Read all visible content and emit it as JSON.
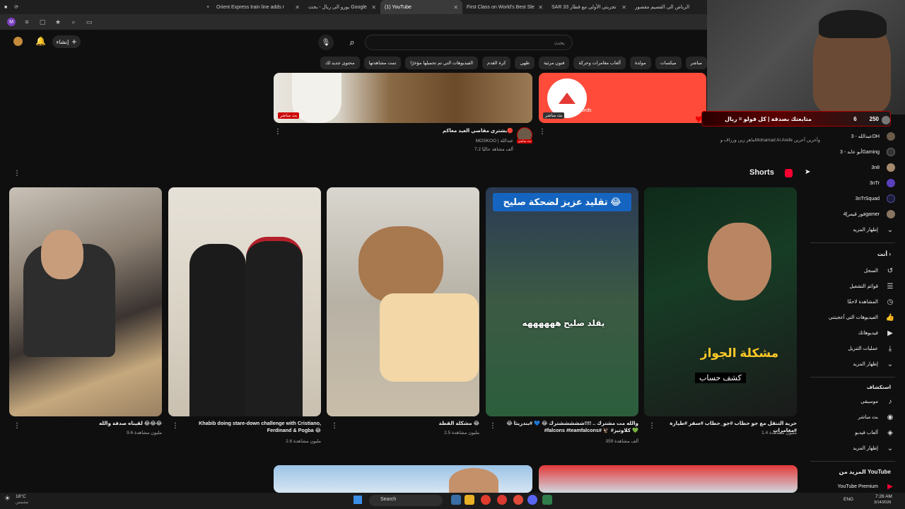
{
  "browser": {
    "tabs": [
      {
        "label": "Orient Express train line adds r",
        "active": false
      },
      {
        "label": "يورو الى ريال - بحث Google",
        "active": false
      },
      {
        "label": "(1) YouTube",
        "active": true
      },
      {
        "label": "First Class on World's Best Sle",
        "active": false
      },
      {
        "label": "SAR 33 تجربتي الأولى مع قطار",
        "active": false
      },
      {
        "label": "الرياض الى القصيم مقصور",
        "active": false
      }
    ],
    "new_tab": "+"
  },
  "yt": {
    "create_label": "إنشاء",
    "search_placeholder": "بحث",
    "chips": [
      "مباشر",
      "ميكسات",
      "مولدة",
      "ألعاب مغامرات وحركة",
      "فنون مرئية",
      "طهي",
      "كرة القدم",
      "الفيديوهات التي تم تحميلها مؤخرًا",
      "تمت مشاهدتها",
      "محتوى جديد لك"
    ],
    "top_videos": [
      {
        "badge": "بث مباشر"
      },
      {
        "badge": "بث مباشر",
        "brand": "akening Records"
      }
    ],
    "featured": {
      "title": "بشتري مقاصي العيد معاكم🔴",
      "channel": "MOSKOO | عبدالله",
      "views": "7.2 ألف مشاهد حاليًا",
      "avatar_badge": "بث مباشر"
    },
    "shorts_heading": "Shorts",
    "shorts": [
      {
        "title": "لقيناه صدفة والله 😂😂😂",
        "views": "9.6 مليون مشاهدة"
      },
      {
        "title": "Khabib doing stare-down challenge with Cristiano, Ferdinand & Pogba 😂",
        "views": "2.6 مليون مشاهدة"
      },
      {
        "title": "مشكلة القطة 😂",
        "views": "2.5 مليون مشاهدة"
      },
      {
        "title": "😂 والله مت مشترك .. !!!!شششششترك 😂 💙 #بندريتا #falcons #teamfalcons# 🦅 #كلاوتيز 💚",
        "views": "359 ألف مشاهدة"
      },
      {
        "title": "حرية التنقل مع جو حطاب #جو_حطاب #سفر #طيارة #مغامرات",
        "views": "1.4 مليون مشاهدة"
      }
    ],
    "short_overlays": {
      "s4_banner": "تقليد عزيز لضحكة صليح 😂",
      "s4_caption": "يقلد صليح ههههههه",
      "s5_title": "مشكلة الجواز",
      "s5_sub": "كشف حساب"
    }
  },
  "sidebar": {
    "subs": [
      {
        "label": "عبدالله - 3DH"
      },
      {
        "label": "أبو عابد - 3Gaming"
      },
      {
        "label": "3n8"
      },
      {
        "label": "3nTr"
      },
      {
        "label": "3nTrSquad"
      },
      {
        "label": "فور قيمر|4gamer"
      }
    ],
    "show_more": "إظهار المزيد",
    "you_heading": "أنت",
    "you_items": [
      {
        "label": "السجل",
        "icon": "history-icon"
      },
      {
        "label": "قوائم التشغيل",
        "icon": "playlist-icon"
      },
      {
        "label": "المشاهدة لاحقًا",
        "icon": "clock-icon"
      },
      {
        "label": "الفيديوهات التي أعجبتني",
        "icon": "like-icon"
      },
      {
        "label": "فيديوهاتك",
        "icon": "video-icon"
      },
      {
        "label": "عمليات التنزيل",
        "icon": "download-icon"
      }
    ],
    "you_more": "إظهار المزيد",
    "explore_heading": "استكشاف",
    "explore_items": [
      {
        "label": "موسيقى",
        "icon": "music-icon"
      },
      {
        "label": "بث مباشر",
        "icon": "live-icon"
      },
      {
        "label": "ألعاب فيديو",
        "icon": "gaming-icon"
      }
    ],
    "explore_more": "إظهار المزيد",
    "more_heading": "المزيد من YouTube",
    "premium": "YouTube Premium"
  },
  "overlay": {
    "text": "متابعتك بصدقة | كل فولو = ريال",
    "count_a": "250",
    "count_b": "6",
    "subline": "ماهر زين ورزاف وMohamad Al Arefe وآخرين آخرين"
  },
  "taskbar": {
    "weather": "18°C",
    "weather_sub": "مشمس",
    "search": "Search",
    "lang": "ENG",
    "time": "7:26 AM",
    "date": "3/14/2026"
  }
}
